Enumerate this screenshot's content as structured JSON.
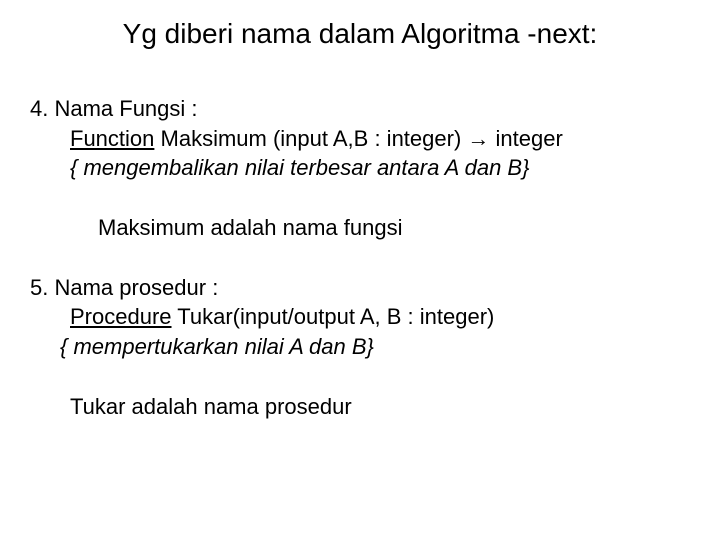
{
  "title": "Yg diberi nama dalam Algoritma -next:",
  "sec4": {
    "heading": "4. Nama Fungsi :",
    "kw": "Function",
    "sig": " Maksimum (input A,B : integer) ",
    "arrow": "→",
    "sig_tail": " integer",
    "comment": "{ mengembalikan nilai terbesar antara A dan B}",
    "note": "Maksimum adalah nama fungsi"
  },
  "sec5": {
    "heading": "5. Nama prosedur :",
    "kw": "Procedure",
    "sig": " Tukar(input/output A, B : integer)",
    "comment": "{ mempertukarkan nilai A dan B}",
    "note": "Tukar adalah nama prosedur"
  }
}
